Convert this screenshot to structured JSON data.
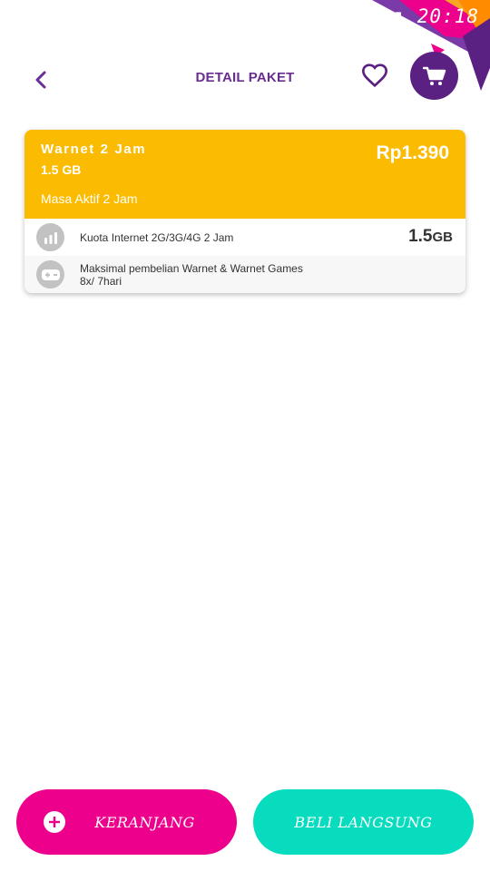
{
  "status_bar": {
    "battery_text": "%",
    "time": "20:18"
  },
  "header": {
    "title": "DETAIL PAKET",
    "back_icon": "chevron-left-icon",
    "favorite_icon": "heart-icon",
    "cart_icon": "cart-icon"
  },
  "package": {
    "name": "Warnet 2 Jam",
    "size": "1.5 GB",
    "price": "Rp1.390",
    "active_period": "Masa Aktif 2 Jam",
    "details": [
      {
        "icon": "signal-bars-icon",
        "label": "Kuota Internet 2G/3G/4G 2 Jam",
        "value": "1.5",
        "unit": "GB"
      },
      {
        "icon": "gamepad-icon",
        "label_line1": "Maksimal pembelian Warnet & Warnet Games",
        "label_line2": "8x/ 7hari"
      }
    ]
  },
  "actions": {
    "add_to_cart": "KERANJANG",
    "buy_now": "BELI LANGSUNG"
  },
  "colors": {
    "brand_purple": "#5b2182",
    "title_purple": "#6a2d91",
    "card_yellow": "#fbbb00",
    "magenta": "#ec008c",
    "teal": "#08dcbf"
  }
}
